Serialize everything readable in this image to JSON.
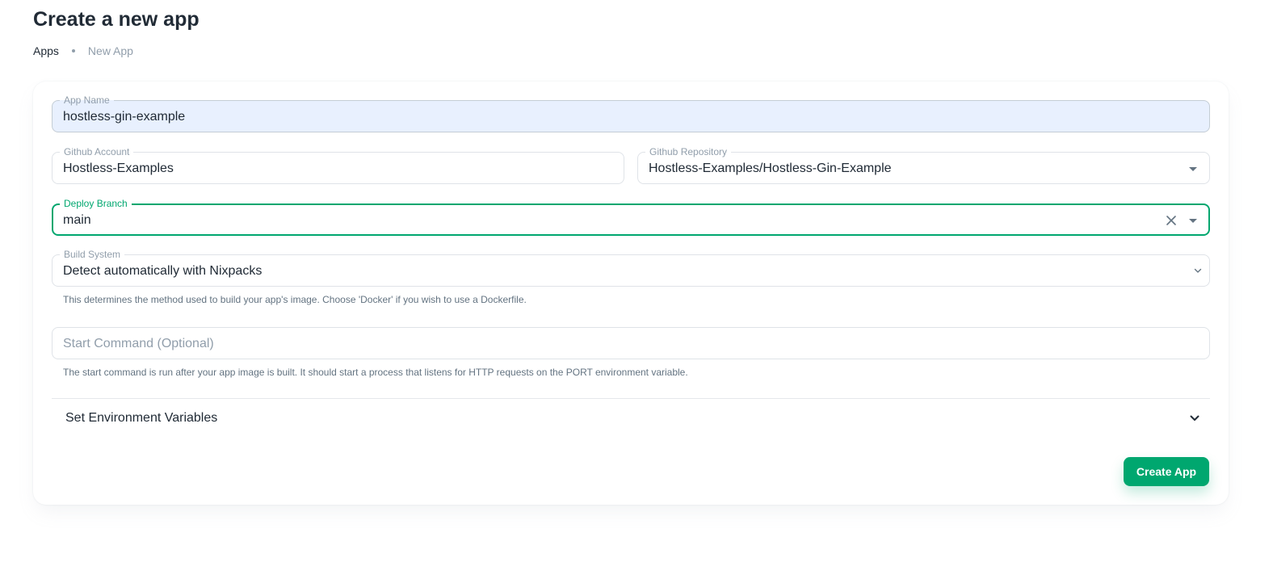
{
  "page": {
    "title": "Create a new app",
    "breadcrumb": {
      "root": "Apps",
      "current": "New App"
    }
  },
  "form": {
    "app_name": {
      "label": "App Name",
      "value": "hostless-gin-example"
    },
    "github_account": {
      "label": "Github Account",
      "value": "Hostless-Examples"
    },
    "github_repository": {
      "label": "Github Repository",
      "value": "Hostless-Examples/Hostless-Gin-Example"
    },
    "deploy_branch": {
      "label": "Deploy Branch",
      "value": "main"
    },
    "build_system": {
      "label": "Build System",
      "value": "Detect automatically with Nixpacks",
      "helper": "This determines the method used to build your app's image. Choose 'Docker' if you wish to use a Dockerfile."
    },
    "start_command": {
      "placeholder": "Start Command (Optional)",
      "helper": "The start command is run after your app image is built. It should start a process that listens for HTTP requests on the PORT environment variable."
    },
    "env_section": {
      "label": "Set Environment Variables"
    },
    "submit_label": "Create App"
  },
  "icons": {
    "dropdown": "caret-down-icon",
    "clear": "close-icon",
    "select_chevron": "chevron-down-icon",
    "expand": "expand-more-icon"
  },
  "colors": {
    "primary": "#00a76f",
    "text": "#212b36",
    "muted": "#919eab",
    "autofill_bg": "#e8f0fe"
  }
}
